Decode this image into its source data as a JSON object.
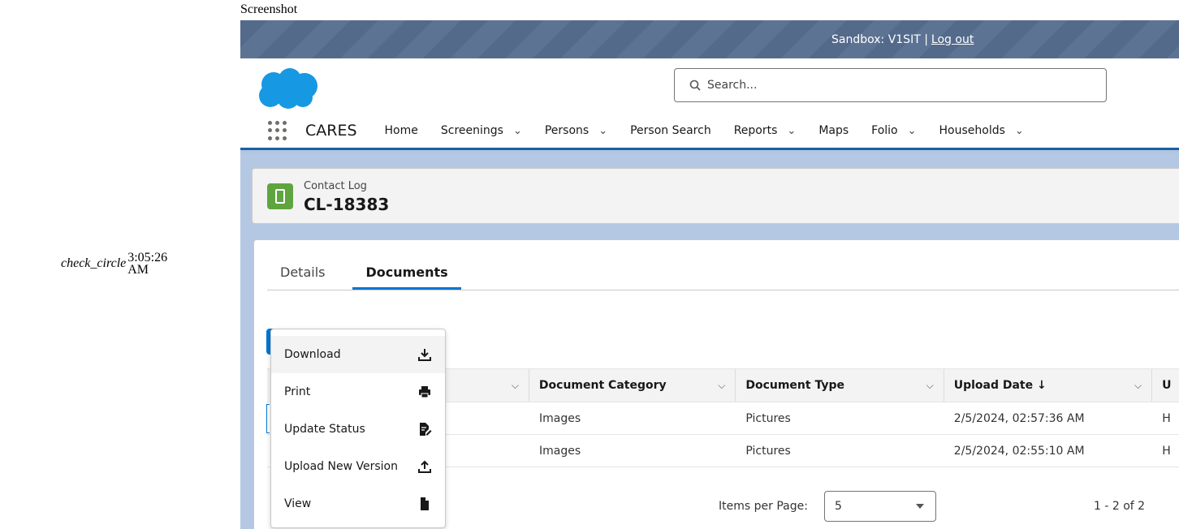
{
  "caption": "Screenshot",
  "side_status": {
    "icon_text": "check_circle",
    "time": "3:05:26 AM"
  },
  "topbar": {
    "sandbox_text": "Sandbox: V1SIT |",
    "logout": "Log out"
  },
  "search": {
    "placeholder": "Search..."
  },
  "nav": {
    "app_name": "CARES",
    "items": [
      {
        "label": "Home",
        "dropdown": false
      },
      {
        "label": "Screenings",
        "dropdown": true
      },
      {
        "label": "Persons",
        "dropdown": true
      },
      {
        "label": "Person Search",
        "dropdown": false
      },
      {
        "label": "Reports",
        "dropdown": true
      },
      {
        "label": "Maps",
        "dropdown": false
      },
      {
        "label": "Folio",
        "dropdown": true
      },
      {
        "label": "Households",
        "dropdown": true
      }
    ],
    "chevron": "⌄"
  },
  "record": {
    "object_label": "Contact Log",
    "title": "CL-18383",
    "icon_color": "#5fa53f"
  },
  "tabs": [
    {
      "label": "Details"
    },
    {
      "label": "Documents"
    }
  ],
  "table": {
    "headers": [
      "",
      "Document Category",
      "Document Type",
      "Upload Date ↓",
      "U"
    ],
    "rows": [
      [
        "",
        "Images",
        "Pictures",
        "2/5/2024, 02:57:36 AM",
        "H"
      ],
      [
        "",
        "Images",
        "Pictures",
        "2/5/2024, 02:55:10 AM",
        "H"
      ]
    ]
  },
  "pager": {
    "label": "Items per Page:",
    "selected": "5",
    "range": "1 - 2 of 2"
  },
  "menu": {
    "items": [
      {
        "label": "Download",
        "icon": "download-icon"
      },
      {
        "label": "Print",
        "icon": "print-icon"
      },
      {
        "label": "Update Status",
        "icon": "edit-document-icon"
      },
      {
        "label": "Upload New Version",
        "icon": "upload-icon"
      },
      {
        "label": "View",
        "icon": "file-icon"
      }
    ]
  },
  "colors": {
    "accent": "#0176d3",
    "header_band": "#546a8a"
  }
}
